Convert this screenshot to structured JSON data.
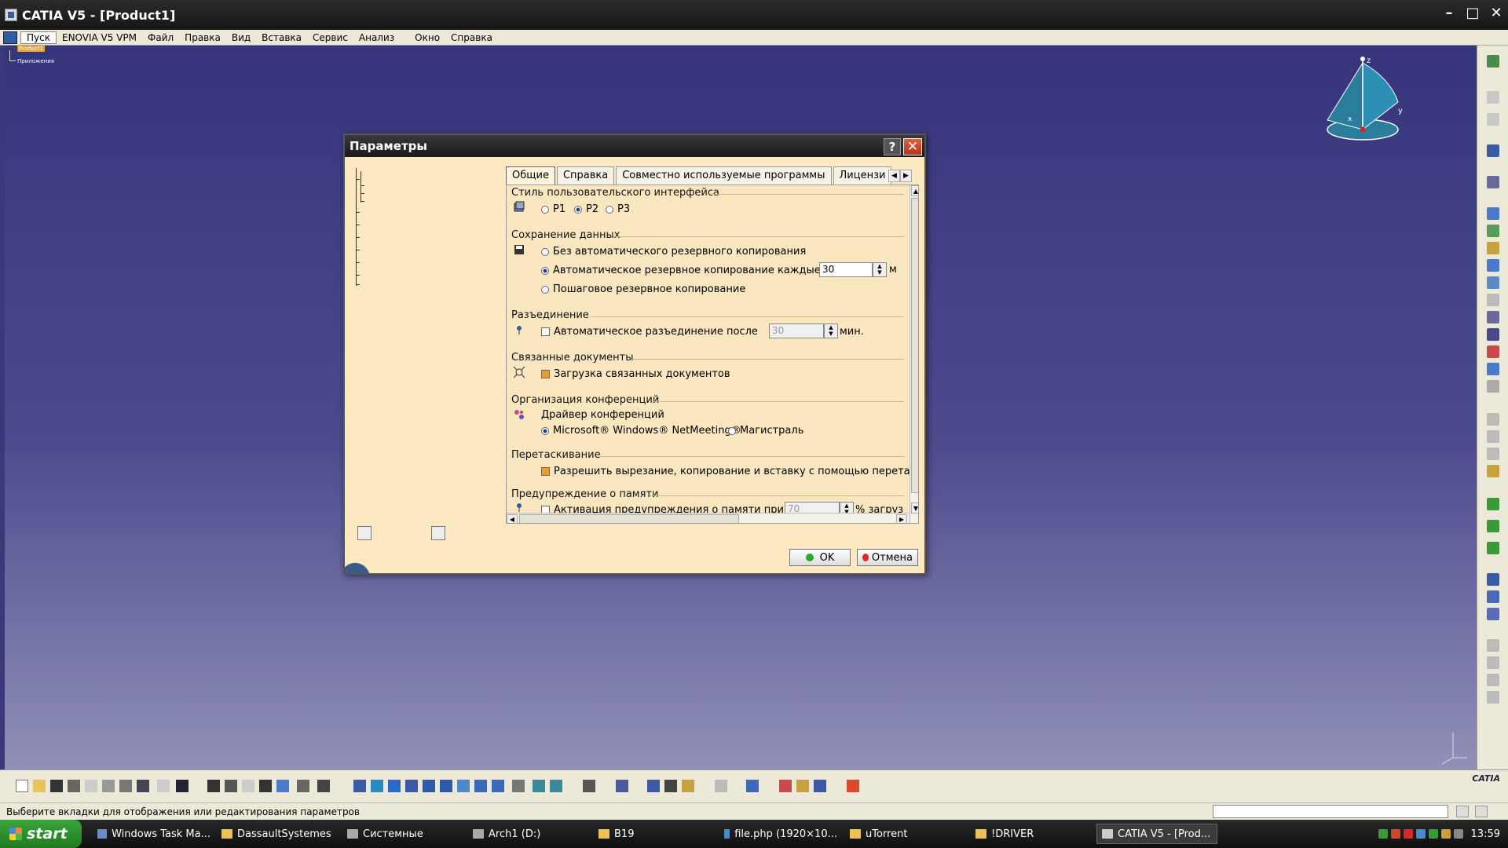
{
  "window": {
    "title": "CATIA V5 - [Product1]"
  },
  "menu": {
    "items": [
      "Пуск",
      "ENOVIA V5 VPM",
      "Файл",
      "Правка",
      "Вид",
      "Вставка",
      "Сервис",
      "Анализ",
      "Окно",
      "Справка"
    ]
  },
  "tree": {
    "root": "Product1",
    "child": "Приложения"
  },
  "dialog": {
    "title": "Параметры",
    "help": "?",
    "close": "✕",
    "tabs": [
      "Общие",
      "Справка",
      "Совместно используемые программы",
      "Лицензи"
    ],
    "sections": {
      "ui_style": {
        "title": "Стиль пользовательского интерфейса",
        "options": [
          "P1",
          "P2",
          "P3"
        ],
        "selected": "P2"
      },
      "data_save": {
        "title": "Сохранение данных",
        "opt_no_backup": "Без автоматического резервного копирования",
        "opt_auto_backup": "Автоматическое резервное копирование каждые",
        "auto_value": "30",
        "auto_unit": "м",
        "opt_incremental": "Пошаговое резервное копирование"
      },
      "disconnect": {
        "title": "Разъединение",
        "label": "Автоматическое разъединение после",
        "value": "30",
        "unit": "мин."
      },
      "linked_docs": {
        "title": "Связанные документы",
        "label": "Загрузка связанных документов"
      },
      "conference": {
        "title": "Организация конференций",
        "driver_label": "Драйвер конференций",
        "opt_netmeeting": "Microsoft® Windows® NetMeeting®",
        "opt_magistral": "Магистраль"
      },
      "drag": {
        "title": "Перетаскивание",
        "label": "Разрешить вырезание, копирование и вставку с помощью перетас"
      },
      "memory": {
        "title": "Предупреждение о памяти",
        "label": "Активация предупреждения о памяти при",
        "value": "70",
        "unit": "% загруз"
      }
    },
    "ok": "OK",
    "cancel": "Отмена"
  },
  "statusbar": {
    "text": "Выберите вкладки для отображения или редактирования параметров"
  },
  "logo": {
    "text": "CATIA"
  },
  "taskbar": {
    "start": "start",
    "tasks": [
      "Windows Task Ma...",
      "DassaultSystemes",
      "Системные",
      "Arch1 (D:)",
      "B19",
      "file.php (1920×10...",
      "uTorrent",
      "!DRIVER",
      "CATIA V5 - [Prod..."
    ],
    "clock": "13:59"
  },
  "colors": {
    "accent": "#1a3ea0",
    "dialog_bg": "#fce9c2",
    "workspace": "#3a3a7a"
  }
}
